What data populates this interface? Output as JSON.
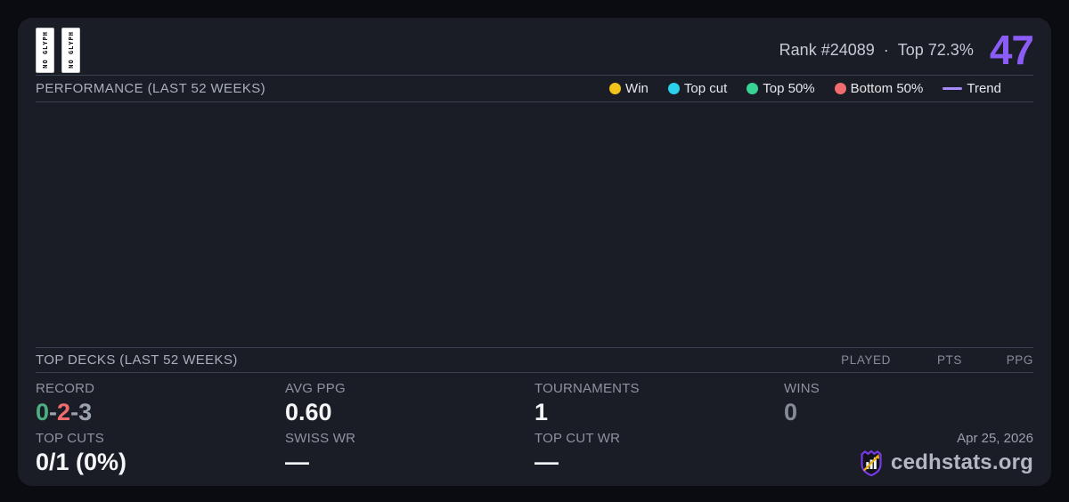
{
  "card": {
    "header": {
      "missing_glyphs": {
        "badge1": "NO GLYPH",
        "badge2": "NO GLYPH"
      },
      "rank_label": "Rank #24089",
      "separator": "·",
      "top_label": "Top 72.3%",
      "score": "47",
      "score_color": "#8b5cf6"
    },
    "performance": {
      "title": "PERFORMANCE (LAST 52 WEEKS)",
      "legend": {
        "items": [
          {
            "label": "Win",
            "color": "#f0c419",
            "marker": "dot"
          },
          {
            "label": "Top cut",
            "color": "#2bd1ea",
            "marker": "dot"
          },
          {
            "label": "Top 50%",
            "color": "#37d392",
            "marker": "dot"
          },
          {
            "label": "Bottom 50%",
            "color": "#f16c6c",
            "marker": "dot"
          },
          {
            "label": "Trend",
            "color": "#a78bfa",
            "marker": "line"
          }
        ]
      },
      "chart_points": []
    },
    "top_decks": {
      "title": "TOP DECKS (LAST 52 WEEKS)",
      "columns": [
        "PLAYED",
        "PTS",
        "PPG"
      ],
      "rows": []
    },
    "stats": {
      "record": {
        "label": "RECORD",
        "wins": "0",
        "losses": "2",
        "draws": "3",
        "sep": "-",
        "wins_color": "#4caf82",
        "losses_color": "#f16d6d",
        "draws_color": "#9ca3af"
      },
      "avg_ppg": {
        "label": "AVG PPG",
        "value": "0.60"
      },
      "tournaments": {
        "label": "TOURNAMENTS",
        "value": "1"
      },
      "wins": {
        "label": "WINS",
        "value": "0"
      },
      "top_cuts": {
        "label": "TOP CUTS",
        "value": "0/1 (0%)"
      },
      "swiss_wr": {
        "label": "SWISS WR",
        "value": "—"
      },
      "top_cut_wr": {
        "label": "TOP CUT WR",
        "value": "—"
      }
    },
    "footer": {
      "date": "Apr 25, 2026",
      "brand": "cedhstats.org"
    }
  }
}
